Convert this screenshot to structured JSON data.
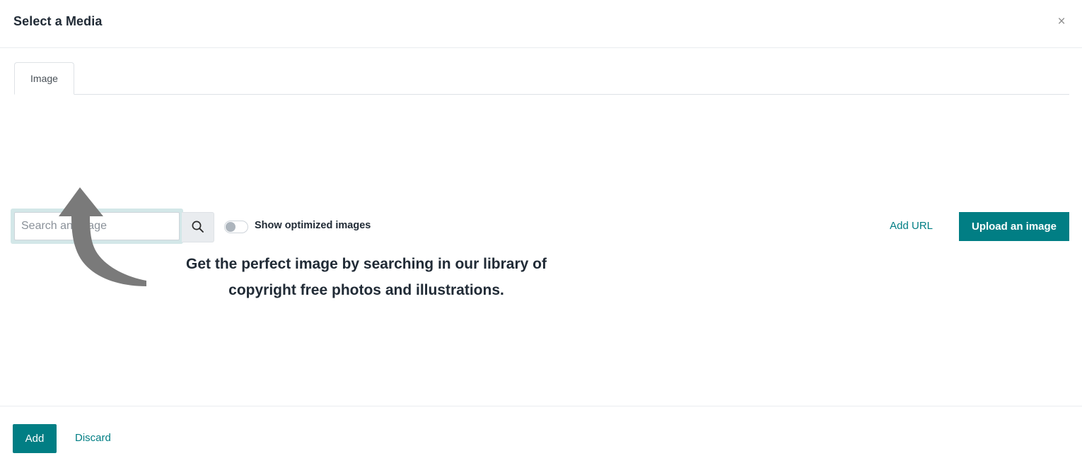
{
  "header": {
    "title": "Select a Media",
    "close_label": "×"
  },
  "tabs": [
    {
      "label": "Image",
      "active": true
    }
  ],
  "toolbar": {
    "search_placeholder": "Search an image",
    "search_value": "",
    "search_button_icon": "search-icon",
    "optimized_toggle": {
      "label": "Show optimized images",
      "state": "off"
    },
    "add_url_label": "Add URL",
    "upload_label": "Upload an image"
  },
  "body": {
    "illustration": "curved-up-arrow",
    "message_line1": "Get the perfect image by searching in our library of",
    "message_line2": "copyright free photos and illustrations."
  },
  "footer": {
    "add_label": "Add",
    "discard_label": "Discard"
  },
  "colors": {
    "accent_teal": "#017e84",
    "focus_ring": "#d3e7e8",
    "text_dark": "#212b36",
    "arrow_grey": "#7a7a7a"
  }
}
